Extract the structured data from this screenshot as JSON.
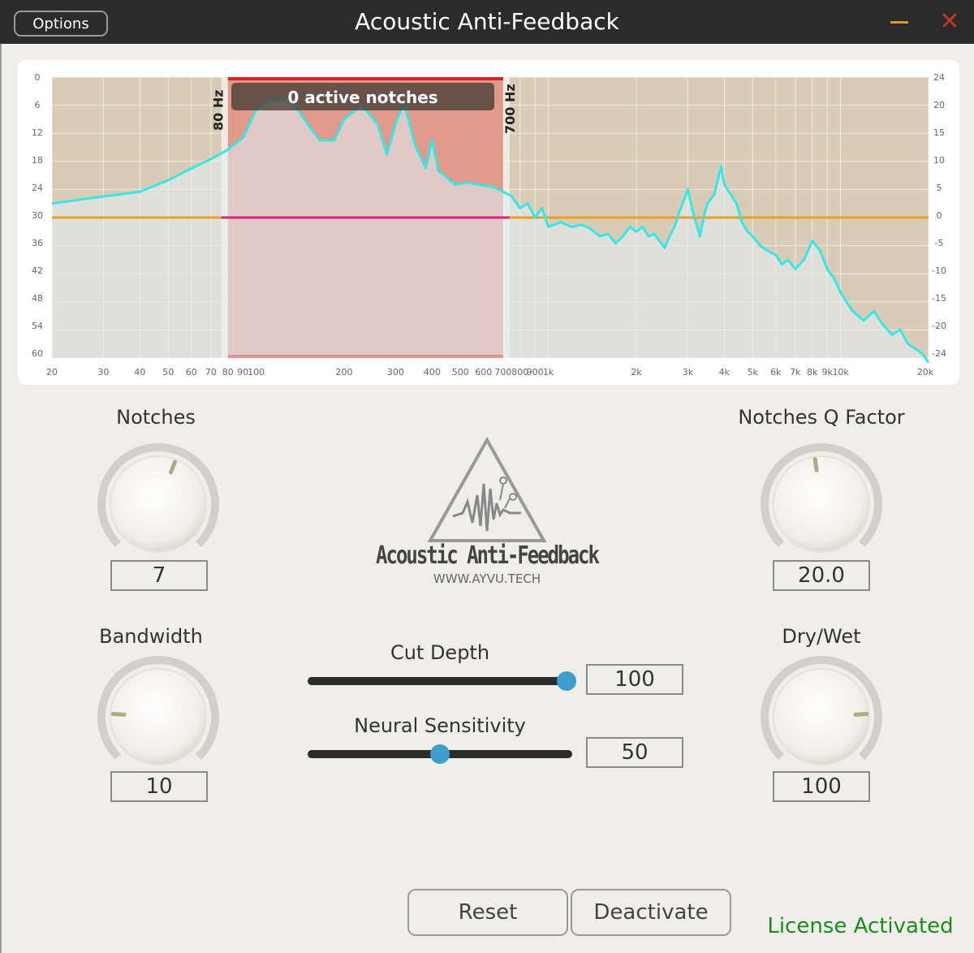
{
  "window": {
    "title": "Acoustic Anti-Feedback",
    "options_label": "Options"
  },
  "graph": {
    "overlay_text": "0 active notches",
    "low_cut_label": "80 Hz",
    "high_cut_label": "700 Hz",
    "left_axis_ticks": [
      "0",
      "6",
      "12",
      "18",
      "24",
      "30",
      "36",
      "42",
      "48",
      "54",
      "60"
    ],
    "right_axis_ticks": [
      "24",
      "20",
      "15",
      "10",
      "5",
      "0",
      "-5",
      "-10",
      "-15",
      "-20",
      "-24"
    ],
    "freq_ticks": [
      {
        "label": "20",
        "f": 20
      },
      {
        "label": "30",
        "f": 30
      },
      {
        "label": "40",
        "f": 40
      },
      {
        "label": "50",
        "f": 50
      },
      {
        "label": "60",
        "f": 60
      },
      {
        "label": "70",
        "f": 70
      },
      {
        "label": "80",
        "f": 80
      },
      {
        "label": "90",
        "f": 90
      },
      {
        "label": "100",
        "f": 100
      },
      {
        "label": "200",
        "f": 200
      },
      {
        "label": "300",
        "f": 300
      },
      {
        "label": "400",
        "f": 400
      },
      {
        "label": "500",
        "f": 500
      },
      {
        "label": "600",
        "f": 600
      },
      {
        "label": "700",
        "f": 700
      },
      {
        "label": "800",
        "f": 800
      },
      {
        "label": "900",
        "f": 900
      },
      {
        "label": "1k",
        "f": 1000
      },
      {
        "label": "2k",
        "f": 2000
      },
      {
        "label": "3k",
        "f": 3000
      },
      {
        "label": "4k",
        "f": 4000
      },
      {
        "label": "5k",
        "f": 5000
      },
      {
        "label": "6k",
        "f": 6000
      },
      {
        "label": "7k",
        "f": 7000
      },
      {
        "label": "8k",
        "f": 8000
      },
      {
        "label": "9k",
        "f": 9000
      },
      {
        "label": "10k",
        "f": 10000
      },
      {
        "label": "20k",
        "f": 20000
      }
    ],
    "band_low_hz": 80,
    "band_high_hz": 700,
    "threshold_db": 30,
    "colors": {
      "spectrum": "#39e6e6",
      "threshold": "#e8a020",
      "threshold_active": "#e0207a",
      "band_fill": "#e09a8a",
      "band_border": "#e02020",
      "plot_bg": "#d9ccb6"
    },
    "spectrum": [
      [
        20,
        27
      ],
      [
        30,
        25.5
      ],
      [
        40,
        24.5
      ],
      [
        50,
        22
      ],
      [
        60,
        19.5
      ],
      [
        70,
        17.5
      ],
      [
        80,
        15.5
      ],
      [
        90,
        13
      ],
      [
        100,
        7
      ],
      [
        110,
        5
      ],
      [
        130,
        4.5
      ],
      [
        150,
        10
      ],
      [
        165,
        13.5
      ],
      [
        185,
        13.5
      ],
      [
        200,
        9
      ],
      [
        230,
        6
      ],
      [
        260,
        10
      ],
      [
        280,
        16.5
      ],
      [
        300,
        10
      ],
      [
        320,
        5.5
      ],
      [
        350,
        14.5
      ],
      [
        380,
        19.5
      ],
      [
        400,
        13.5
      ],
      [
        420,
        20
      ],
      [
        450,
        21.5
      ],
      [
        480,
        23
      ],
      [
        530,
        22.5
      ],
      [
        580,
        23
      ],
      [
        650,
        23.5
      ],
      [
        700,
        24.5
      ],
      [
        750,
        25.5
      ],
      [
        800,
        28
      ],
      [
        850,
        27
      ],
      [
        900,
        30
      ],
      [
        950,
        28
      ],
      [
        1000,
        32
      ],
      [
        1100,
        31
      ],
      [
        1200,
        32
      ],
      [
        1300,
        31.5
      ],
      [
        1400,
        32.5
      ],
      [
        1500,
        34
      ],
      [
        1600,
        33.5
      ],
      [
        1700,
        35.5
      ],
      [
        1800,
        34
      ],
      [
        1900,
        32
      ],
      [
        2000,
        33
      ],
      [
        2100,
        32
      ],
      [
        2200,
        34
      ],
      [
        2300,
        33.5
      ],
      [
        2400,
        35
      ],
      [
        2500,
        36.5
      ],
      [
        2600,
        34
      ],
      [
        2700,
        32
      ],
      [
        2800,
        29
      ],
      [
        2900,
        26.5
      ],
      [
        3000,
        24
      ],
      [
        3100,
        28
      ],
      [
        3200,
        31
      ],
      [
        3300,
        34
      ],
      [
        3400,
        30
      ],
      [
        3500,
        27
      ],
      [
        3700,
        25
      ],
      [
        3800,
        22
      ],
      [
        3900,
        19
      ],
      [
        4000,
        23
      ],
      [
        4200,
        25
      ],
      [
        4400,
        27
      ],
      [
        4600,
        31
      ],
      [
        4800,
        33
      ],
      [
        5000,
        34
      ],
      [
        5300,
        36
      ],
      [
        5600,
        37
      ],
      [
        6000,
        38
      ],
      [
        6300,
        40
      ],
      [
        6600,
        39
      ],
      [
        7000,
        41
      ],
      [
        7500,
        39
      ],
      [
        8000,
        35
      ],
      [
        8500,
        37
      ],
      [
        9000,
        41
      ],
      [
        9500,
        43
      ],
      [
        10000,
        46
      ],
      [
        11000,
        50
      ],
      [
        12000,
        52
      ],
      [
        13000,
        50
      ],
      [
        14000,
        53
      ],
      [
        15000,
        55
      ],
      [
        16000,
        54
      ],
      [
        17000,
        57
      ],
      [
        18000,
        58
      ],
      [
        19000,
        59
      ],
      [
        20000,
        61
      ]
    ]
  },
  "controls": {
    "notches": {
      "label": "Notches",
      "value": "7",
      "level": 0.58
    },
    "notches_q": {
      "label": "Notches Q Factor",
      "value": "20.0",
      "level": 0.47
    },
    "bandwidth": {
      "label": "Bandwidth",
      "value": "10",
      "level": 0.18
    },
    "dry_wet": {
      "label": "Dry/Wet",
      "value": "100",
      "level": 0.82
    },
    "cut_depth": {
      "label": "Cut Depth",
      "value": "100",
      "level": 1.0
    },
    "neural_sensitivity": {
      "label": "Neural Sensitivity",
      "value": "50",
      "level": 0.5
    }
  },
  "logo": {
    "name": "Acoustic Anti-Feedback",
    "url": "WWW.AYVU.TECH"
  },
  "buttons": {
    "reset": "Reset",
    "deactivate": "Deactivate"
  },
  "status": {
    "license": "License Activated"
  },
  "colors": {
    "accent": "#3d9ec9",
    "license": "#1e8a1e"
  }
}
